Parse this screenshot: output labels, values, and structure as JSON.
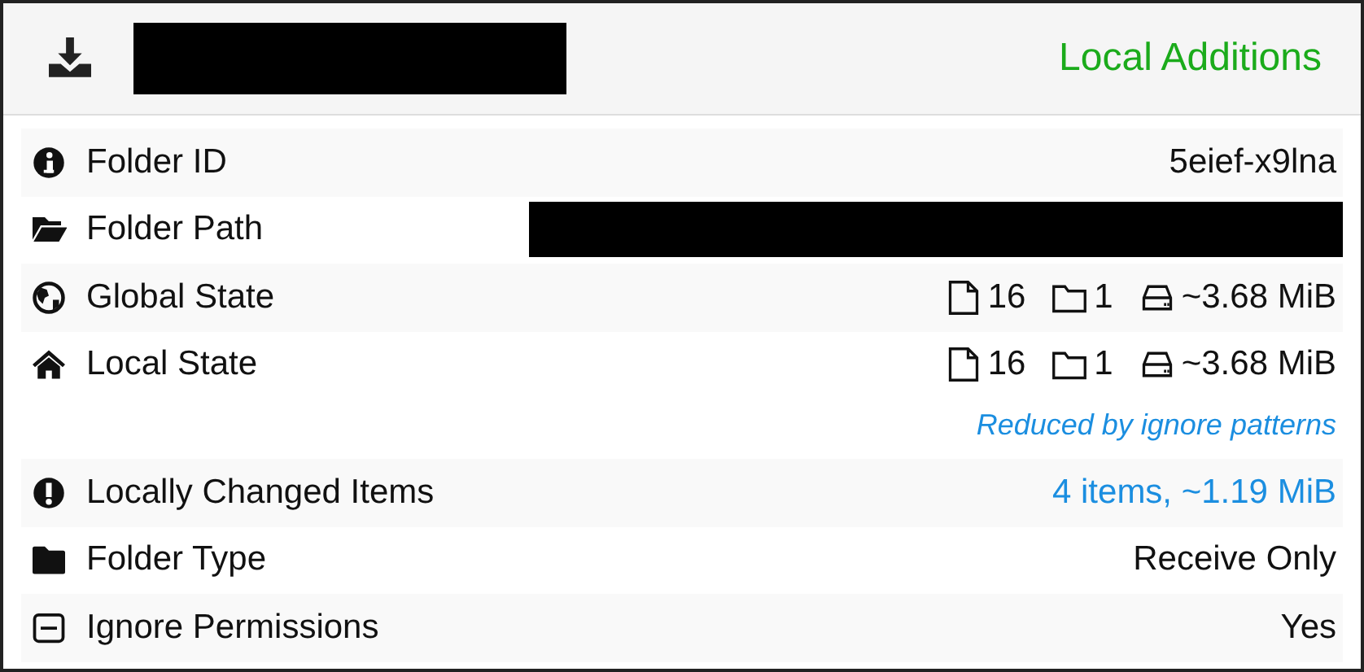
{
  "header": {
    "status": "Local Additions"
  },
  "rows": [
    {
      "label": "Folder ID",
      "kind": "text",
      "value": "5eief-x9lna"
    },
    {
      "label": "Folder Path",
      "kind": "redacted"
    },
    {
      "label": "Global State",
      "kind": "stats",
      "stats": [
        "16",
        "1",
        "~3.68 MiB"
      ]
    },
    {
      "label": "Local State",
      "kind": "stats",
      "stats": [
        "16",
        "1",
        "~3.68 MiB"
      ],
      "note": "Reduced by ignore patterns"
    },
    {
      "label": "Locally Changed Items",
      "kind": "link",
      "value": "4 items, ~1.19 MiB"
    },
    {
      "label": "Folder Type",
      "kind": "text",
      "value": "Receive Only"
    },
    {
      "label": "Ignore Permissions",
      "kind": "text",
      "value": "Yes"
    }
  ]
}
